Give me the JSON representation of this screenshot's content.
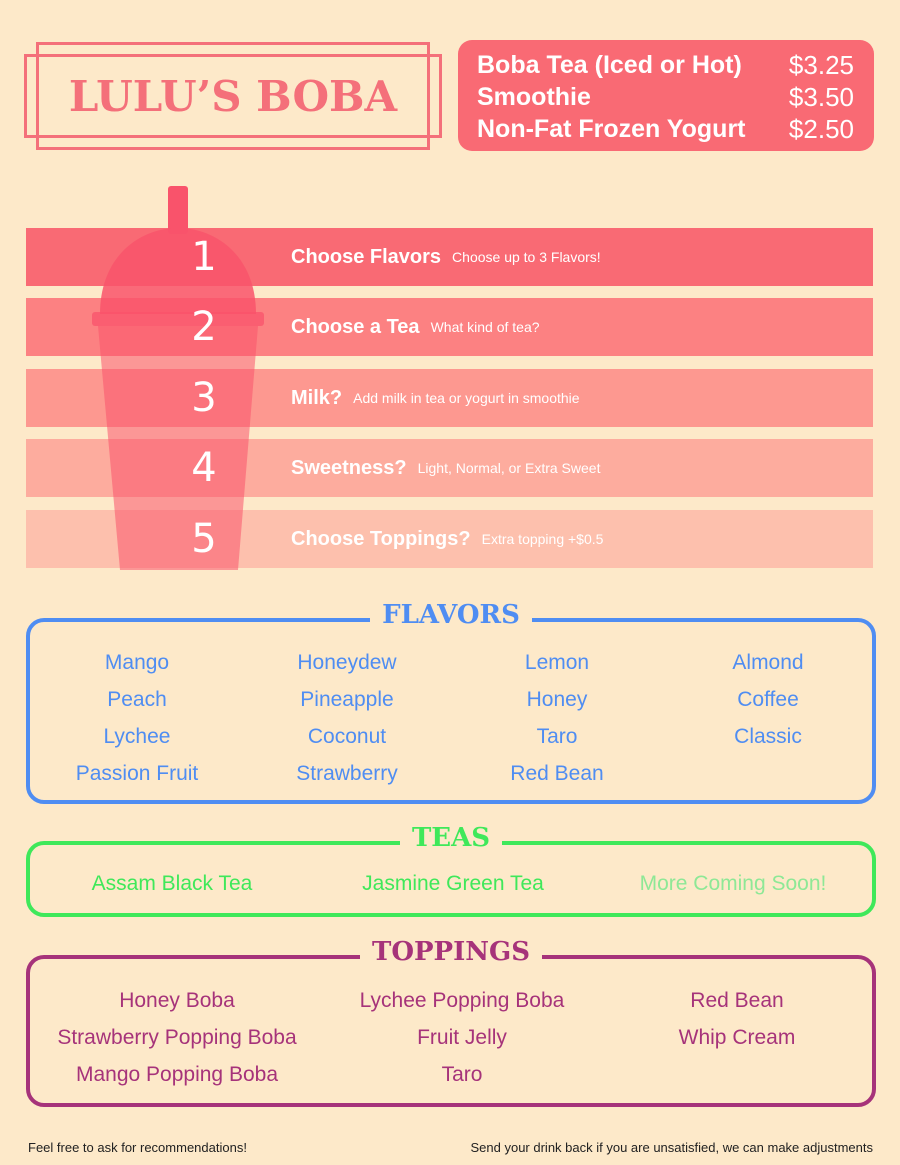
{
  "logo": {
    "text": "LULU’S BOBA"
  },
  "prices": [
    {
      "name": "Boba Tea (Iced or Hot)",
      "price": "$3.25"
    },
    {
      "name": "Smoothie",
      "price": "$3.50"
    },
    {
      "name": "Non-Fat Frozen Yogurt",
      "price": "$2.50"
    }
  ],
  "steps": [
    {
      "num": "1",
      "title": "Choose Flavors",
      "sub": "Choose up to 3 Flavors!"
    },
    {
      "num": "2",
      "title": "Choose a Tea",
      "sub": "What kind of tea?"
    },
    {
      "num": "3",
      "title": "Milk?",
      "sub": "Add milk in tea or yogurt in smoothie"
    },
    {
      "num": "4",
      "title": "Sweetness?",
      "sub": "Light, Normal, or Extra Sweet"
    },
    {
      "num": "5",
      "title": "Choose Toppings?",
      "sub": "Extra topping +$0.5"
    }
  ],
  "flavors": {
    "title": "FLAVORS",
    "items": [
      "Mango",
      "Honeydew",
      "Lemon",
      "Almond",
      "Peach",
      "Pineapple",
      "Honey",
      "Coffee",
      "Lychee",
      "Coconut",
      "Taro",
      "Classic",
      "Passion Fruit",
      "Strawberry",
      "Red Bean"
    ]
  },
  "teas": {
    "title": "TEAS",
    "items": [
      "Assam Black Tea",
      "Jasmine Green Tea",
      "More Coming Soon!"
    ]
  },
  "toppings": {
    "title": "TOPPINGS",
    "items": [
      "Honey Boba",
      "Lychee Popping Boba",
      "Red Bean",
      "Strawberry Popping Boba",
      "Fruit Jelly",
      "Whip Cream",
      "Mango Popping Boba",
      "Taro"
    ]
  },
  "footer": {
    "left": "Feel free to ask for recommendations!",
    "right": "Send your drink back if you are unsatisfied, we can make adjustments"
  },
  "colors": {
    "background": "#fde9c9",
    "accent": "#f96a74",
    "flavors": "#4f8df2",
    "teas": "#3fe85a",
    "toppings": "#a6337a"
  }
}
